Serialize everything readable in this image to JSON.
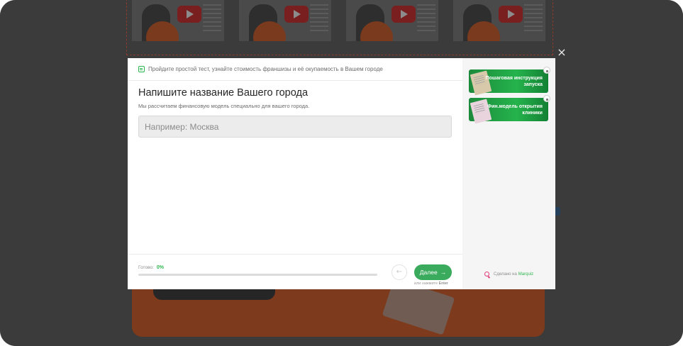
{
  "modal": {
    "topbar_hint": "Пройдите простой тест, узнайте стоимость франшизы и её окупаемость в Вашем городе",
    "question_title": "Напишите название Вашего города",
    "question_subtitle": "Мы рассчитаем финансовую модель специально для вашего города.",
    "city_input": {
      "placeholder": "Например: Москва",
      "value": ""
    },
    "footer": {
      "ready_label": "Готово:",
      "progress_text": "0%",
      "progress_value": 0,
      "back_label": "←",
      "next_label": "Далее",
      "next_arrow": "→",
      "enter_hint_prefix": "или нажмите",
      "enter_hint_key": "Enter"
    },
    "close_label": "×"
  },
  "sidebar": {
    "bonuses": [
      {
        "label": "Пошаговая инструкция запуска",
        "icon": "document-icon",
        "locked": true
      },
      {
        "label": "Фин.модель открытия клиники",
        "icon": "document-icon",
        "locked": true
      }
    ],
    "made_by_prefix": "Сделано на",
    "made_by_brand": "Marquiz"
  },
  "colors": {
    "accent_green": "#2db54f",
    "button_green": "#3aaa5c",
    "brand_pink": "#e23d7a",
    "overlay": "#3a3a3a"
  }
}
